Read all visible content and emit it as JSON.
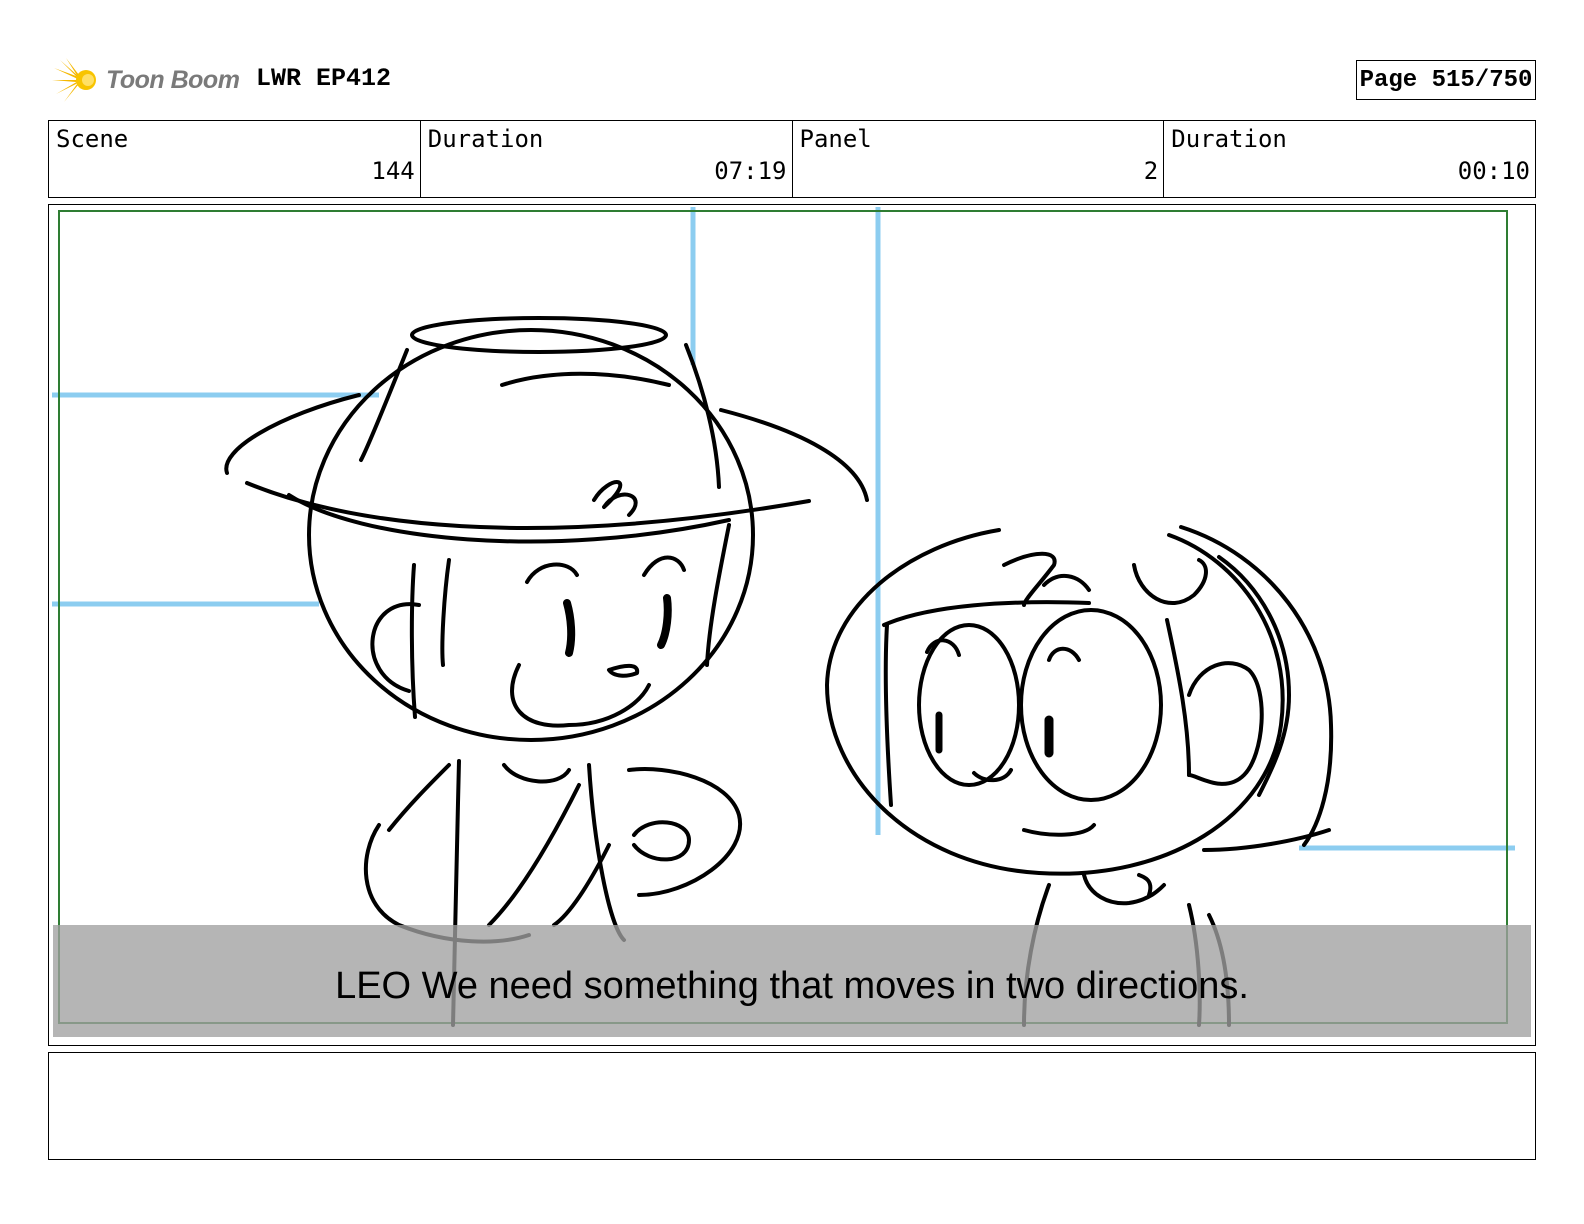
{
  "header": {
    "logo_text": "Toon Boom",
    "project_title": "LWR EP412",
    "page_indicator": "Page 515/750"
  },
  "info": [
    {
      "label": "Scene",
      "value": "144"
    },
    {
      "label": "Duration",
      "value": "07:19"
    },
    {
      "label": "Panel",
      "value": "2"
    },
    {
      "label": "Duration",
      "value": "00:10"
    }
  ],
  "panel": {
    "caption": "LEO We need something that moves in two directions."
  },
  "notes": {
    "text": ""
  },
  "colors": {
    "guide_lines": "#8ccdf0",
    "safe_frame": "#2e7d32",
    "caption_bar": "#a0a0a0",
    "logo_star": "#f5b800"
  }
}
